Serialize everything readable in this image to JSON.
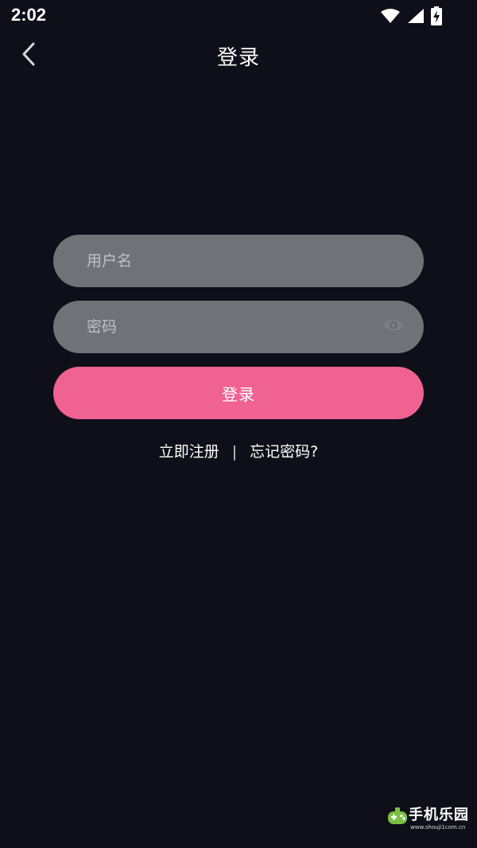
{
  "status_bar": {
    "time": "2:02",
    "icons": [
      "wifi-icon",
      "cell-signal-icon",
      "battery-charging-icon"
    ]
  },
  "header": {
    "title": "登录",
    "back_icon": "chevron-left-icon"
  },
  "form": {
    "username": {
      "value": "",
      "placeholder": "用户名"
    },
    "password": {
      "value": "",
      "placeholder": "密码",
      "toggle_icon": "eye-icon"
    },
    "login_label": "登录"
  },
  "links": {
    "register": "立即注册",
    "separator": "|",
    "forgot": "忘记密码?"
  },
  "watermark": {
    "brand": "手机乐园",
    "url": "www.shouji1com.cn",
    "logo_icon": "game-controller-icon"
  },
  "colors": {
    "background": "#0f0f1a",
    "field": "#717278",
    "primary": "#f06292",
    "watermark_green": "#7bc043"
  }
}
